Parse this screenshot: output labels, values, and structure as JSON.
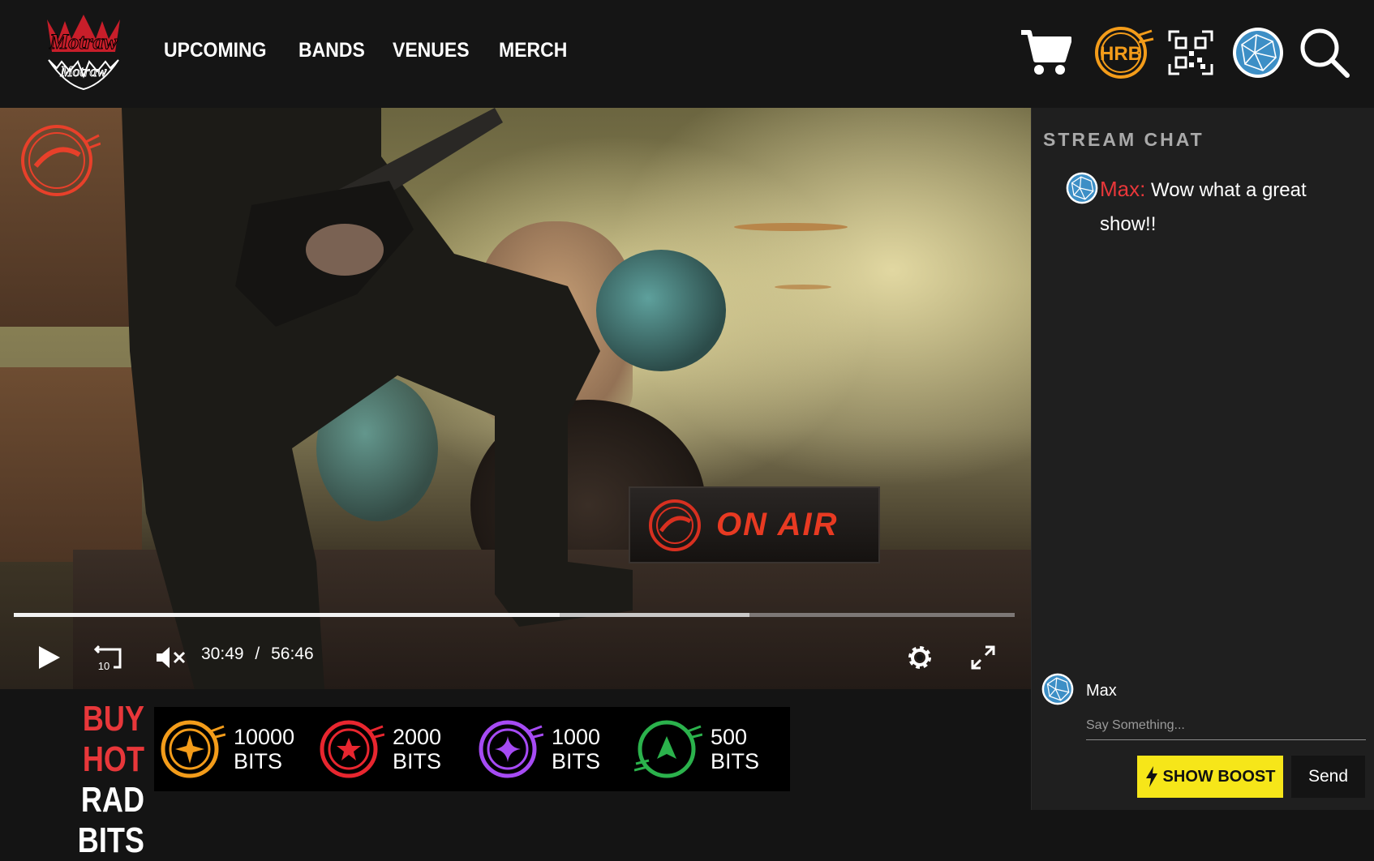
{
  "header": {
    "logo_alt": "Motraw",
    "nav": [
      "UPCOMING",
      "BANDS",
      "VENUES",
      "MERCH"
    ],
    "icons": [
      "cart-icon",
      "hrb-coin-icon",
      "qr-code-icon",
      "globe-avatar-icon",
      "search-icon"
    ],
    "hrb_label": "HRB"
  },
  "video": {
    "sign_text": "ON AIR",
    "current_time": "30:49",
    "separator": "/",
    "duration": "56:46",
    "played_fraction": 0.545,
    "buffered_fraction": 0.735,
    "rewind_seconds": "10"
  },
  "bits": {
    "title_line1": "BUY HOT",
    "title_line2": "RAD BITS",
    "packs": [
      {
        "amount": "10000",
        "unit": "BITS",
        "color": "#f39c1a"
      },
      {
        "amount": "2000",
        "unit": "BITS",
        "color": "#e8262f"
      },
      {
        "amount": "1000",
        "unit": "BITS",
        "color": "#a64bf4"
      },
      {
        "amount": "500",
        "unit": "BITS",
        "color": "#2bb24c"
      }
    ]
  },
  "chat": {
    "title": "STREAM CHAT",
    "messages": [
      {
        "user": "Max:",
        "text": "Wow what a great show!!"
      }
    ],
    "composer_name": "Max",
    "placeholder": "Say Something...",
    "boost_label": "SHOW BOOST",
    "send_label": "Send"
  },
  "colors": {
    "accent_red": "#e8373a",
    "boost_yellow": "#f6e619",
    "hrb_orange": "#f39c1a"
  }
}
